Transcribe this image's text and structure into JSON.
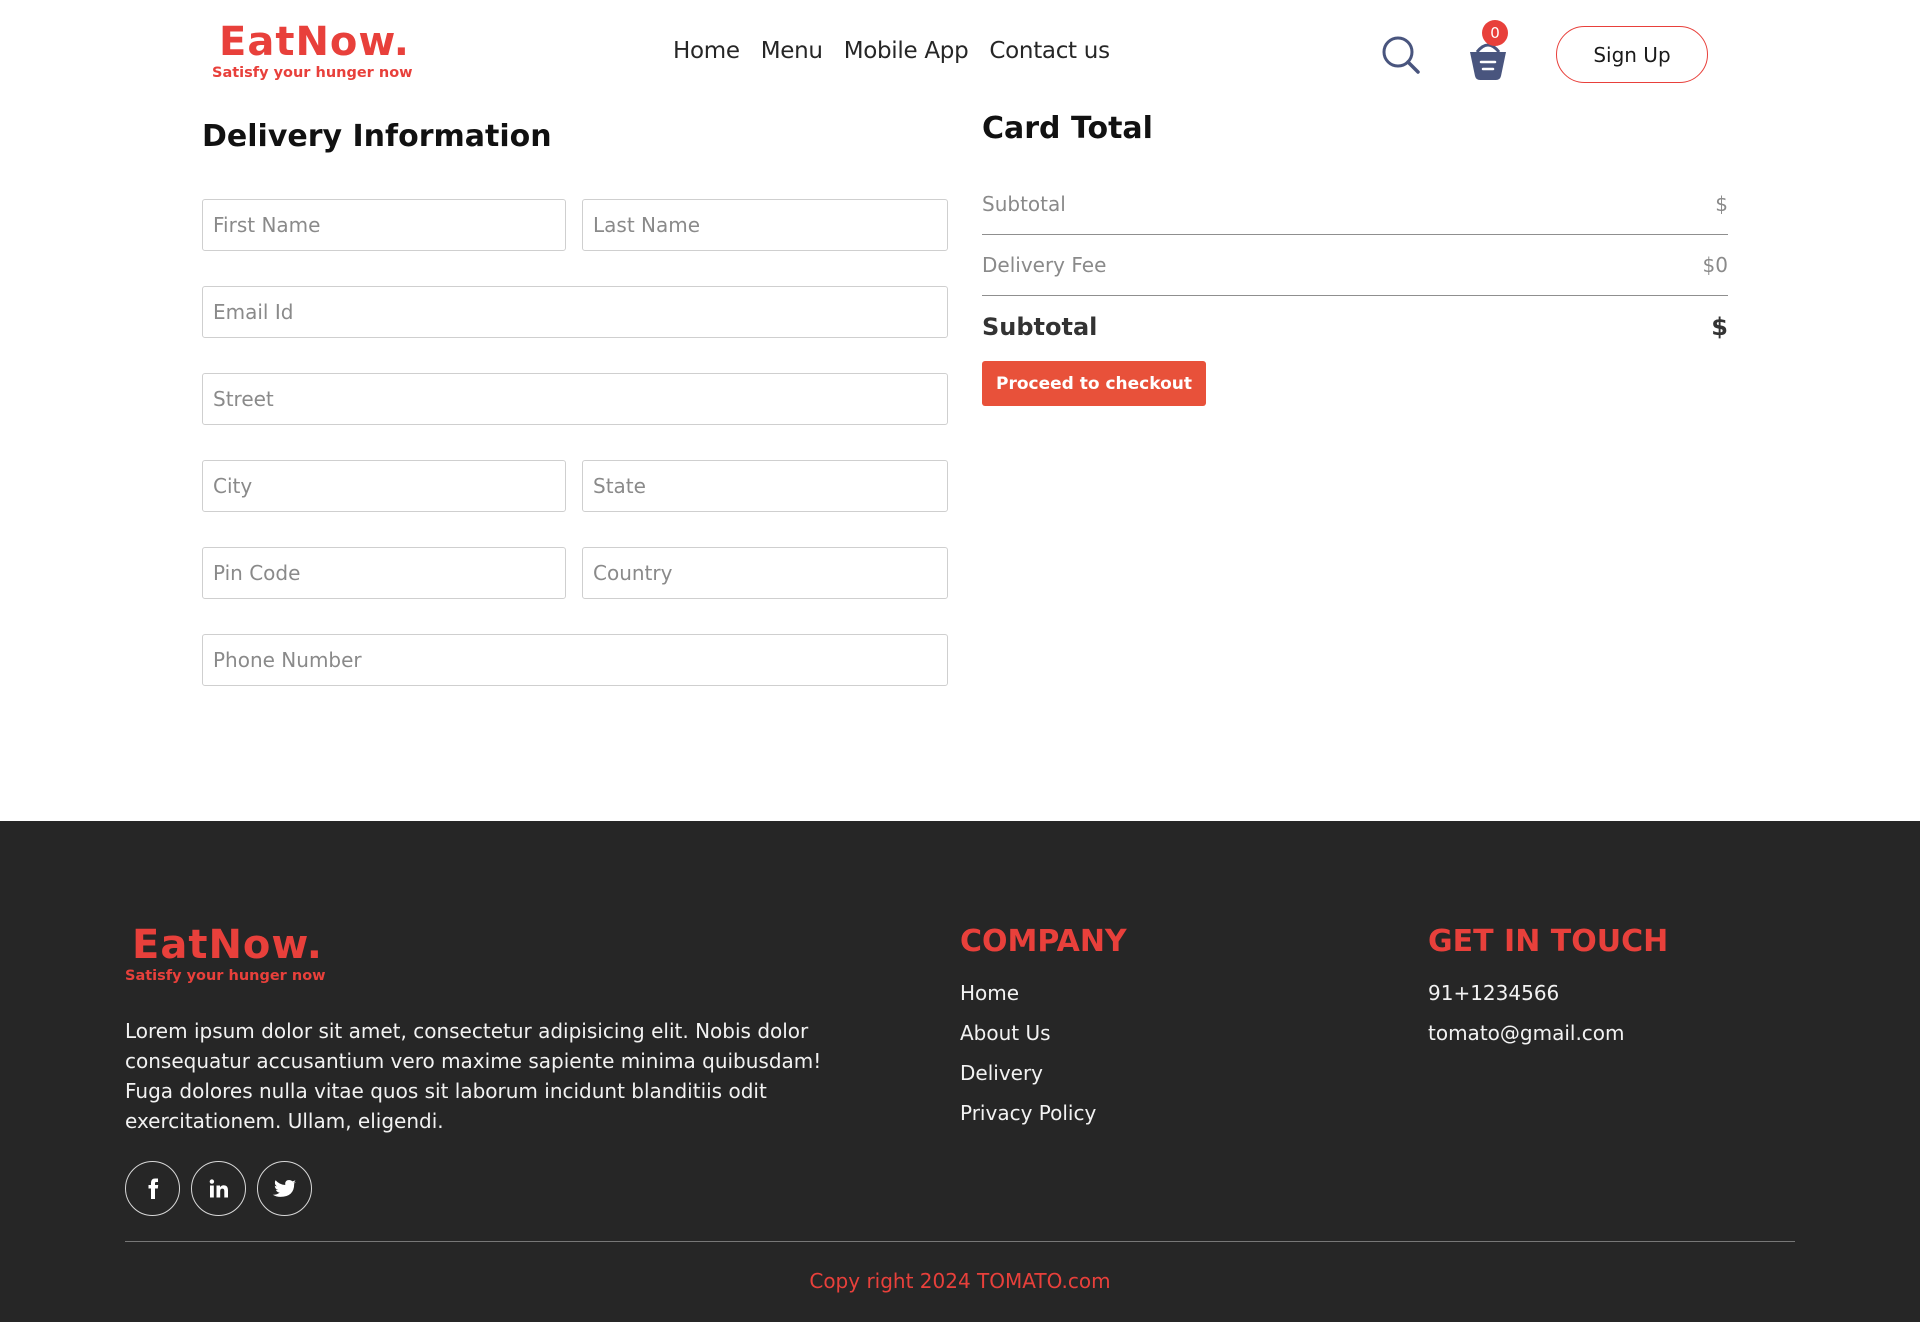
{
  "brand": {
    "name": "EatNow.",
    "tagline": "Satisfy your hunger now",
    "color": "#e8403b"
  },
  "nav": {
    "items": [
      "Home",
      "Menu",
      "Mobile App",
      "Contact us"
    ]
  },
  "header": {
    "cart_count": "0",
    "signup_label": "Sign Up",
    "search_icon": "search-icon",
    "cart_icon": "basket-icon"
  },
  "delivery": {
    "title": "Delivery Information",
    "fields": {
      "first_name": "First Name",
      "last_name": "Last Name",
      "email": "Email Id",
      "street": "Street",
      "city": "City",
      "state": "State",
      "pin": "Pin Code",
      "country": "Country",
      "phone": "Phone Number"
    }
  },
  "totals": {
    "title": "Card Total",
    "subtotal_label": "Subtotal",
    "subtotal_value": "$",
    "fee_label": "Delivery Fee",
    "fee_value": "$0",
    "total_label": "Subtotal",
    "total_value": "$",
    "checkout_label": "Proceed to checkout",
    "accent": "#e8513a"
  },
  "footer": {
    "description": "Lorem ipsum dolor sit amet, consectetur adipisicing elit. Nobis dolor consequatur accusantium vero maxime sapiente minima quibusdam! Fuga dolores nulla vitae quos sit laborum incidunt blanditiis odit exercitationem. Ullam, eligendi.",
    "company_title": "COMPANY",
    "company_links": [
      "Home",
      "About Us",
      "Delivery",
      "Privacy Policy"
    ],
    "contact_title": "GET IN TOUCH",
    "phone": "91+1234566",
    "email": "tomato@gmail.com",
    "socials": [
      "facebook-icon",
      "linkedin-icon",
      "twitter-icon"
    ],
    "copyright": "Copy right 2024 TOMATO.com",
    "background": "#262626"
  }
}
